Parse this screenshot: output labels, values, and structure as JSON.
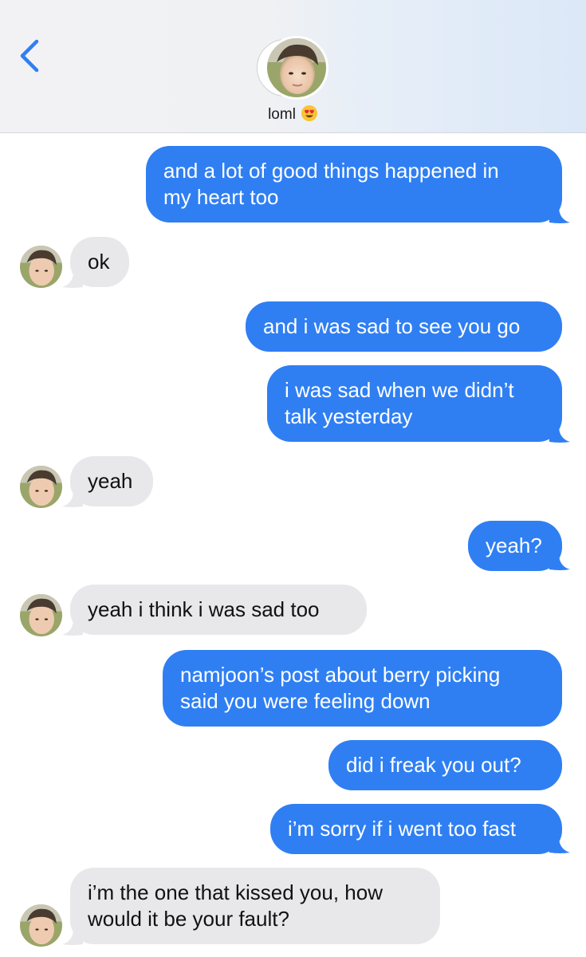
{
  "header": {
    "back_icon": "chevron-left-icon",
    "contact_name": "loml",
    "contact_emoji": "heart-eyes-emoji-icon"
  },
  "colors": {
    "sent_bubble": "#2f7ff3",
    "received_bubble": "#e8e8eb",
    "accent": "#2f7ff3"
  },
  "messages": [
    {
      "from": "me",
      "lines": [
        "and a lot of good things happened in",
        "my heart too"
      ]
    },
    {
      "from": "them",
      "lines": [
        "ok"
      ]
    },
    {
      "from": "me",
      "lines": [
        "and i was sad to see you go"
      ]
    },
    {
      "from": "me",
      "lines": [
        "i was sad when we didn’t",
        "talk yesterday"
      ]
    },
    {
      "from": "them",
      "lines": [
        "yeah"
      ]
    },
    {
      "from": "me",
      "lines": [
        "yeah?"
      ]
    },
    {
      "from": "them",
      "lines": [
        "yeah i think i was sad too"
      ]
    },
    {
      "from": "me",
      "lines": [
        "namjoon’s post about berry picking",
        "said you were feeling down"
      ]
    },
    {
      "from": "me",
      "lines": [
        "did i freak you out?"
      ]
    },
    {
      "from": "me",
      "lines": [
        "i’m sorry if i went too fast"
      ]
    },
    {
      "from": "them",
      "lines": [
        "i’m the one that kissed you, how",
        "would it be your fault?"
      ]
    }
  ]
}
